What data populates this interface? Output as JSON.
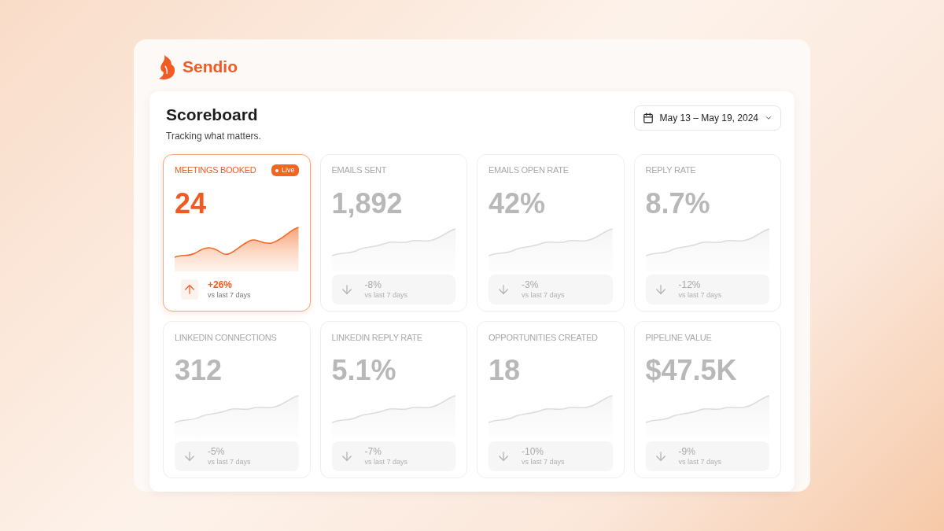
{
  "brand": {
    "name": "Sendio"
  },
  "header": {
    "title": "Scoreboard",
    "subtitle": "Tracking what matters.",
    "date_range": "May 13 – May 19, 2024"
  },
  "metrics": [
    {
      "label": "MEETINGS BOOKED",
      "value": "24",
      "change": "+26%",
      "period": "vs last 7 days",
      "kind": "up",
      "selected": true,
      "badge": "Live"
    },
    {
      "label": "EMAILS SENT",
      "value": "1,892",
      "change": "-8%",
      "period": "vs last 7 days",
      "kind": "down",
      "selected": false
    },
    {
      "label": "EMAILS OPEN RATE",
      "value": "42%",
      "change": "-3%",
      "period": "vs last 7 days",
      "kind": "down",
      "selected": false
    },
    {
      "label": "REPLY RATE",
      "value": "8.7%",
      "change": "-12%",
      "period": "vs last 7 days",
      "kind": "down",
      "selected": false
    },
    {
      "label": "LINKEDIN CONNECTIONS",
      "value": "312",
      "change": "-5%",
      "period": "vs last 7 days",
      "kind": "down",
      "selected": false
    },
    {
      "label": "LINKEDIN REPLY RATE",
      "value": "5.1%",
      "change": "-7%",
      "period": "vs last 7 days",
      "kind": "down",
      "selected": false
    },
    {
      "label": "OPPORTUNITIES CREATED",
      "value": "18",
      "change": "-10%",
      "period": "vs last 7 days",
      "kind": "down",
      "selected": false
    },
    {
      "label": "PIPELINE VALUE",
      "value": "$47.5K",
      "change": "-9%",
      "period": "vs last 7 days",
      "kind": "down",
      "selected": false
    }
  ]
}
